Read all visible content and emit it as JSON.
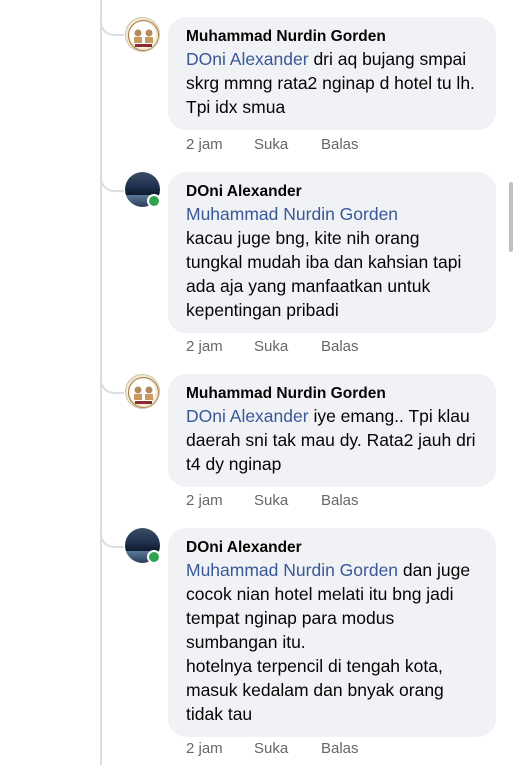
{
  "comments": [
    {
      "author": "Muhammad Nurdin Gorden",
      "mention": "DOni Alexander",
      "text": " dri aq bujang smpai skrg mmng rata2 nginap d hotel tu lh. Tpi idx smua",
      "avatar": "org-logo",
      "time": "2 jam",
      "like": "Suka",
      "reply": "Balas"
    },
    {
      "author": "DOni Alexander",
      "mention": "Muhammad Nurdin Gorden",
      "text": "kacau juge bng, kite nih orang tungkal mudah iba dan kahsian tapi ada aja yang manfaatkan untuk kepentingan pribadi",
      "avatar": "photo",
      "online": true,
      "time": "2 jam",
      "like": "Suka",
      "reply": "Balas"
    },
    {
      "author": "Muhammad Nurdin Gorden",
      "mention": "DOni Alexander",
      "text": " iye emang.. Tpi klau daerah sni tak mau dy. Rata2 jauh dri t4 dy nginap",
      "avatar": "org-logo",
      "time": "2 jam",
      "like": "Suka",
      "reply": "Balas"
    },
    {
      "author": "DOni Alexander",
      "mention": "Muhammad Nurdin Gorden",
      "text": " dan juge cocok nian hotel melati itu bng jadi tempat nginap para modus sumbangan itu.\nhotelnya terpencil di tengah kota, masuk kedalam dan bnyak orang tidak tau",
      "avatar": "photo",
      "online": true,
      "time": "2 jam",
      "like": "Suka",
      "reply": "Balas"
    }
  ],
  "colors": {
    "mention": "#385898",
    "bubble": "#f0f2f5",
    "meta": "#65676b",
    "online": "#31a24c"
  }
}
